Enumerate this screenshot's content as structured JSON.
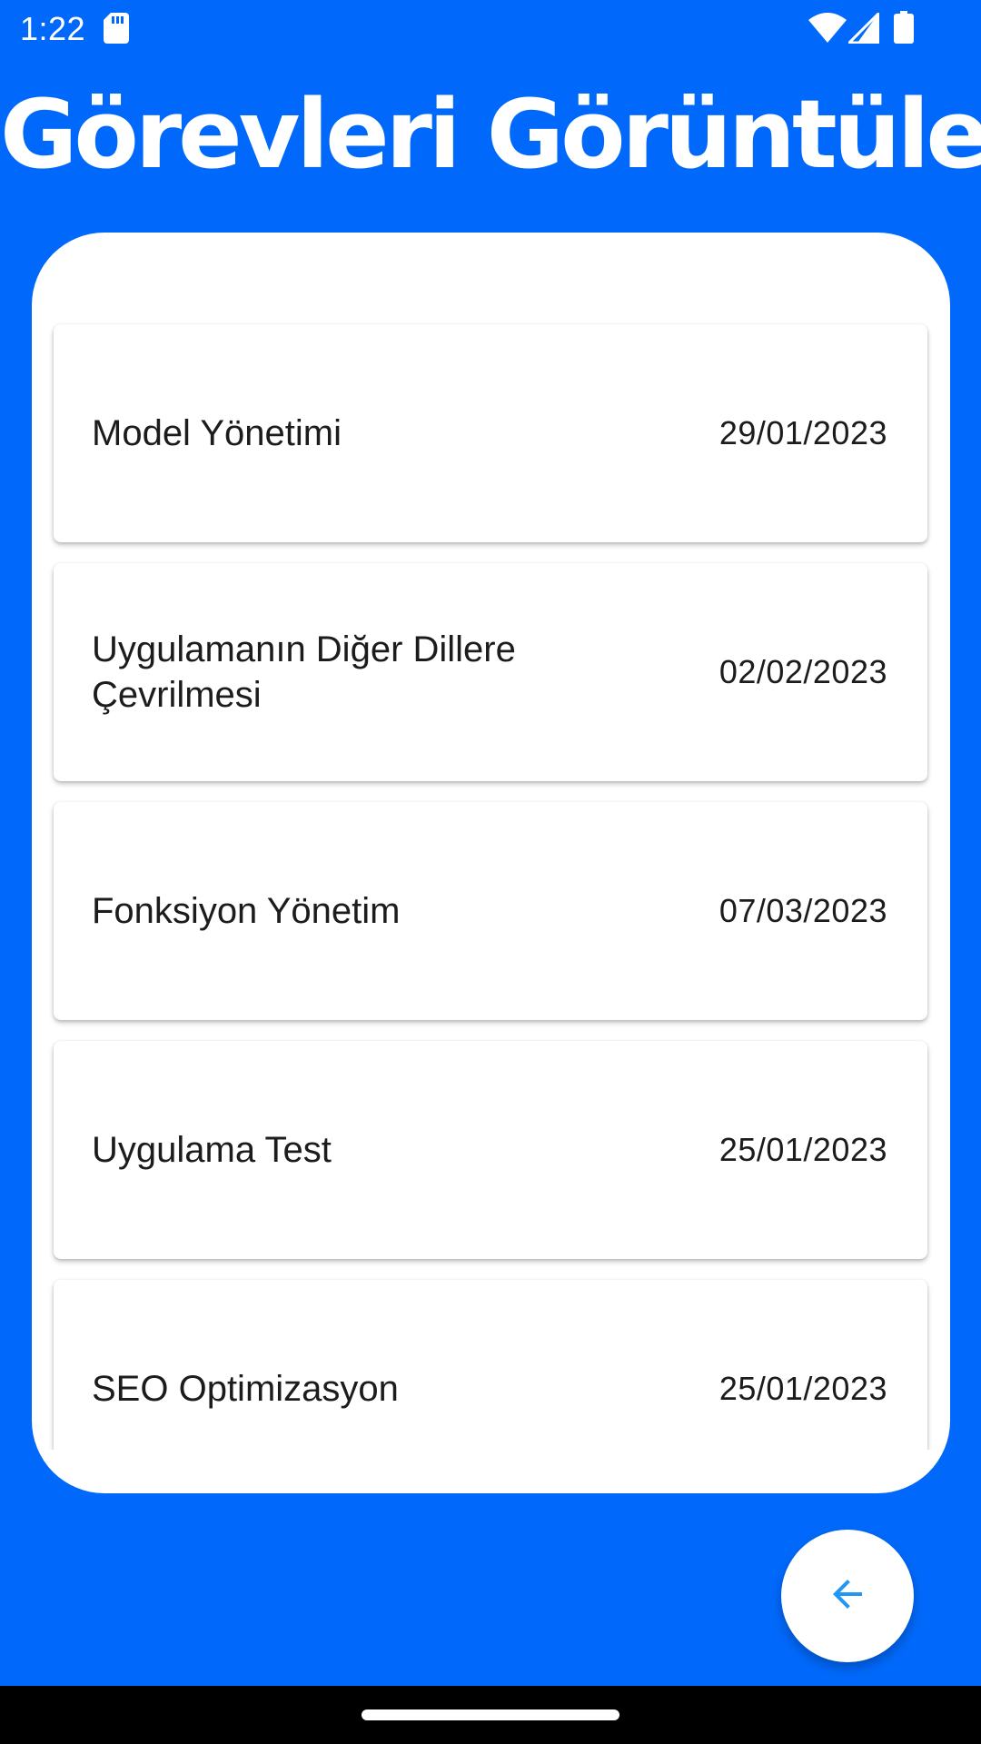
{
  "status_bar": {
    "time": "1:22"
  },
  "header": {
    "title": "Görevleri Görüntüle"
  },
  "tasks": [
    {
      "name": "Model Yönetimi",
      "date": "29/01/2023"
    },
    {
      "name": "Uygulamanın Diğer Dillere Çevrilmesi",
      "date": "02/02/2023"
    },
    {
      "name": "Fonksiyon Yönetim",
      "date": "07/03/2023"
    },
    {
      "name": "Uygulama Test",
      "date": "25/01/2023"
    },
    {
      "name": "SEO Optimizasyon",
      "date": "25/01/2023"
    }
  ],
  "fab": {
    "icon": "arrow-back-icon"
  },
  "colors": {
    "background": "#0069fb",
    "card": "#ffffff",
    "text": "#1c1c1c",
    "fab_icon": "#2196f3"
  }
}
